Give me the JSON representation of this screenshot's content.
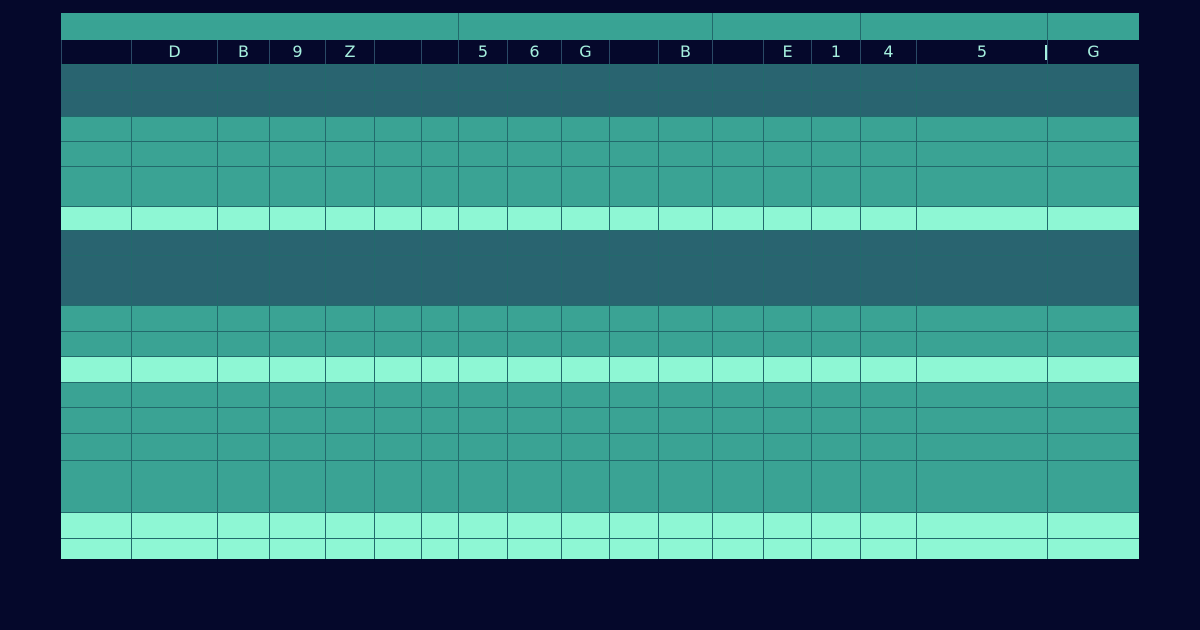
{
  "header_labels": [
    "",
    "D",
    "B",
    "9",
    "Z",
    "",
    "",
    "5",
    "6",
    "G",
    "",
    "B",
    "",
    "E",
    "1",
    "4",
    "5",
    "G"
  ],
  "row_styles": [
    "dark",
    "dark",
    "mid",
    "mid",
    "mid",
    "light",
    "dark",
    "dark",
    "mid",
    "mid",
    "light",
    "mid",
    "mid",
    "mid",
    "mid",
    "light",
    "light"
  ],
  "colors": {
    "background": "#05082b",
    "group_bar": "#39a394",
    "dark_row": "#296470",
    "mid_row": "#3aa394",
    "light_row": "#8ef7d4",
    "header_text": "#a6f0df",
    "grid_line": "#226a6c"
  }
}
